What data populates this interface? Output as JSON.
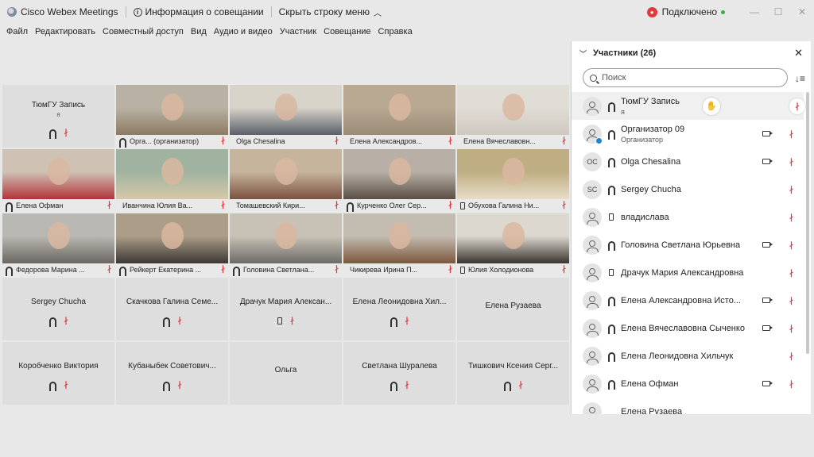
{
  "titlebar": {
    "app_name": "Cisco Webex Meetings",
    "info_label": "Информация о совещании",
    "hide_menu_label": "Скрыть строку меню",
    "connection_label": "Подключено"
  },
  "menu": [
    "Файл",
    "Редактировать",
    "Совместный доступ",
    "Вид",
    "Аудио и видео",
    "Участник",
    "Совещание",
    "Справка"
  ],
  "grid": {
    "tiles": [
      {
        "name": "ТюмГУ Запись",
        "sub": "я",
        "type": "empty",
        "icons": [
          "headset",
          "mic"
        ]
      },
      {
        "name": "Орга... (организатор)",
        "type": "video",
        "icon": "headset-host",
        "colors": [
          "#b9b2a4",
          "#8c7b63"
        ]
      },
      {
        "name": "Olga Chesalina",
        "type": "video",
        "icon": "",
        "colors": [
          "#d8d4ca",
          "#5a5f6a"
        ]
      },
      {
        "name": "Елена Александров...",
        "type": "video",
        "icon": "",
        "colors": [
          "#b9a892",
          "#9a8b77"
        ]
      },
      {
        "name": "Елена Вячеславовн...",
        "type": "video",
        "icon": "",
        "colors": [
          "#e0ddd6",
          "#cfc8c0"
        ]
      },
      {
        "name": "Елена Офман",
        "type": "video",
        "icon": "headset",
        "colors": [
          "#cfc2b4",
          "#b2343a"
        ]
      },
      {
        "name": "Иванчина Юлия Ва...",
        "type": "video",
        "icon": "",
        "colors": [
          "#9fb3a0",
          "#d6c8a8"
        ]
      },
      {
        "name": "Томашевский Кири...",
        "type": "video",
        "icon": "",
        "colors": [
          "#c7b49c",
          "#7a5340"
        ]
      },
      {
        "name": "Курченко Олег Сер...",
        "type": "video",
        "icon": "headset",
        "colors": [
          "#b8b0a6",
          "#5b4f46"
        ]
      },
      {
        "name": "Обухова Галина Ни...",
        "type": "video",
        "icon": "phone",
        "colors": [
          "#bfae84",
          "#e8dcc6"
        ]
      },
      {
        "name": "Федорова Марина ...",
        "type": "video",
        "icon": "headset",
        "active": true,
        "colors": [
          "#b9b8b2",
          "#6b6661"
        ]
      },
      {
        "name": "Рейкерт Екатерина ...",
        "type": "video",
        "icon": "headset",
        "colors": [
          "#ab9d88",
          "#3d3734"
        ]
      },
      {
        "name": "Головина Светлана...",
        "type": "video",
        "icon": "headset",
        "colors": [
          "#c8c2b6",
          "#6d6a67"
        ]
      },
      {
        "name": "Чикирева Ирина П...",
        "type": "video",
        "icon": "",
        "colors": [
          "#c2bcb1",
          "#7d573d"
        ]
      },
      {
        "name": "Юлия Холодионова",
        "type": "video",
        "icon": "phone",
        "colors": [
          "#ddd8cf",
          "#3a3430"
        ]
      },
      {
        "name": "Sergey Chucha",
        "type": "empty",
        "icons": [
          "headset",
          "mic"
        ]
      },
      {
        "name": "Скачкова Галина Семе...",
        "type": "empty",
        "icons": [
          "headset",
          "mic"
        ]
      },
      {
        "name": "Драчук Мария Алексан...",
        "type": "empty",
        "icons": [
          "phone",
          "mic"
        ]
      },
      {
        "name": "Елена Леонидовна Хил...",
        "type": "empty",
        "icons": [
          "headset",
          "mic"
        ]
      },
      {
        "name": "Елена Рузаева",
        "type": "empty",
        "icons": []
      },
      {
        "name": "Коробченко Виктория",
        "type": "empty",
        "icons": [
          "headset",
          "mic"
        ]
      },
      {
        "name": "Кубаныбек Советович...",
        "type": "empty",
        "icons": [
          "headset",
          "mic"
        ]
      },
      {
        "name": "Ольга",
        "type": "empty",
        "icons": []
      },
      {
        "name": "Светлана Шуралева",
        "type": "empty",
        "icons": [
          "headset",
          "mic"
        ]
      },
      {
        "name": "Тишкович Ксения Серг...",
        "type": "empty",
        "icons": [
          "headset",
          "mic"
        ]
      }
    ]
  },
  "panel": {
    "title": "Участники (26)",
    "search_placeholder": "Поиск",
    "participants": [
      {
        "name": "ТюмГУ Запись",
        "sub": "я",
        "initials": "",
        "device": "headset",
        "hand": true,
        "camera": false
      },
      {
        "name": "Организатор 09",
        "sub": "Организатор",
        "initials": "",
        "device": "headset",
        "host": true,
        "camera": true
      },
      {
        "name": "Olga Chesalina",
        "sub": "",
        "initials": "OC",
        "device": "headset",
        "camera": true
      },
      {
        "name": "Sergey Chucha",
        "sub": "",
        "initials": "SC",
        "device": "headset",
        "camera": false
      },
      {
        "name": "владислава",
        "sub": "",
        "initials": "",
        "device": "phone",
        "camera": false
      },
      {
        "name": "Головина Светлана Юрьевна",
        "sub": "",
        "initials": "",
        "device": "headset",
        "camera": true
      },
      {
        "name": "Драчук Мария Александровна",
        "sub": "",
        "initials": "",
        "device": "phone",
        "camera": false
      },
      {
        "name": "Елена Александровна Исто...",
        "sub": "",
        "initials": "",
        "device": "headset",
        "camera": true
      },
      {
        "name": "Елена Вячеславовна Сыченко",
        "sub": "",
        "initials": "",
        "device": "headset",
        "camera": true
      },
      {
        "name": "Елена Леонидовна Хильчук",
        "sub": "",
        "initials": "",
        "device": "headset",
        "camera": false
      },
      {
        "name": "Елена Офман",
        "sub": "",
        "initials": "",
        "device": "headset",
        "camera": true
      },
      {
        "name": "Елена Рузаева",
        "sub": "",
        "initials": "",
        "device": "",
        "camera": false
      }
    ]
  },
  "colors": {
    "accent": "#2b9fd8",
    "muted_mic": "#e0393e",
    "connected": "#2fb24c"
  }
}
